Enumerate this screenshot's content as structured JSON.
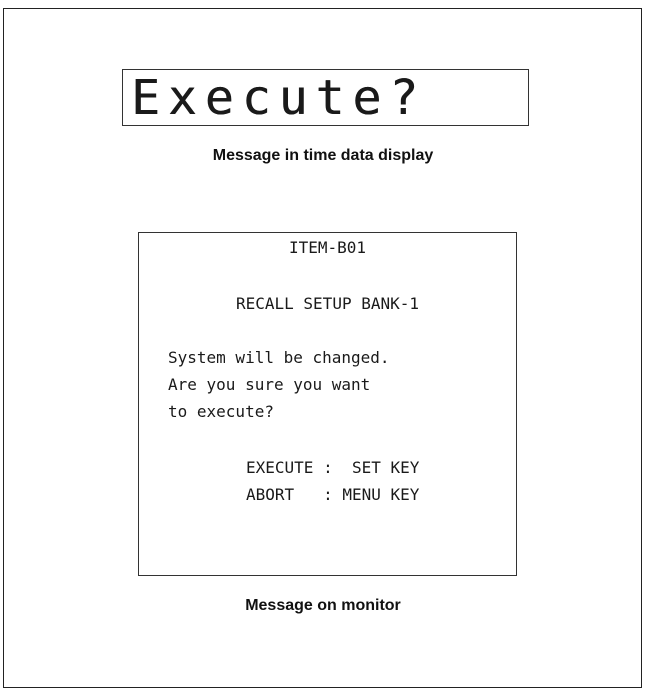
{
  "time_data_display": {
    "text": "Execute?",
    "caption": "Message in time data display"
  },
  "monitor": {
    "item_code": "ITEM-B01",
    "title": "RECALL SETUP BANK-1",
    "message_lines": [
      "System will be changed.",
      "Are you sure you want",
      "to execute?"
    ],
    "key_lines": [
      "EXECUTE :  SET KEY",
      "ABORT   : MENU KEY"
    ],
    "caption": "Message on monitor"
  }
}
